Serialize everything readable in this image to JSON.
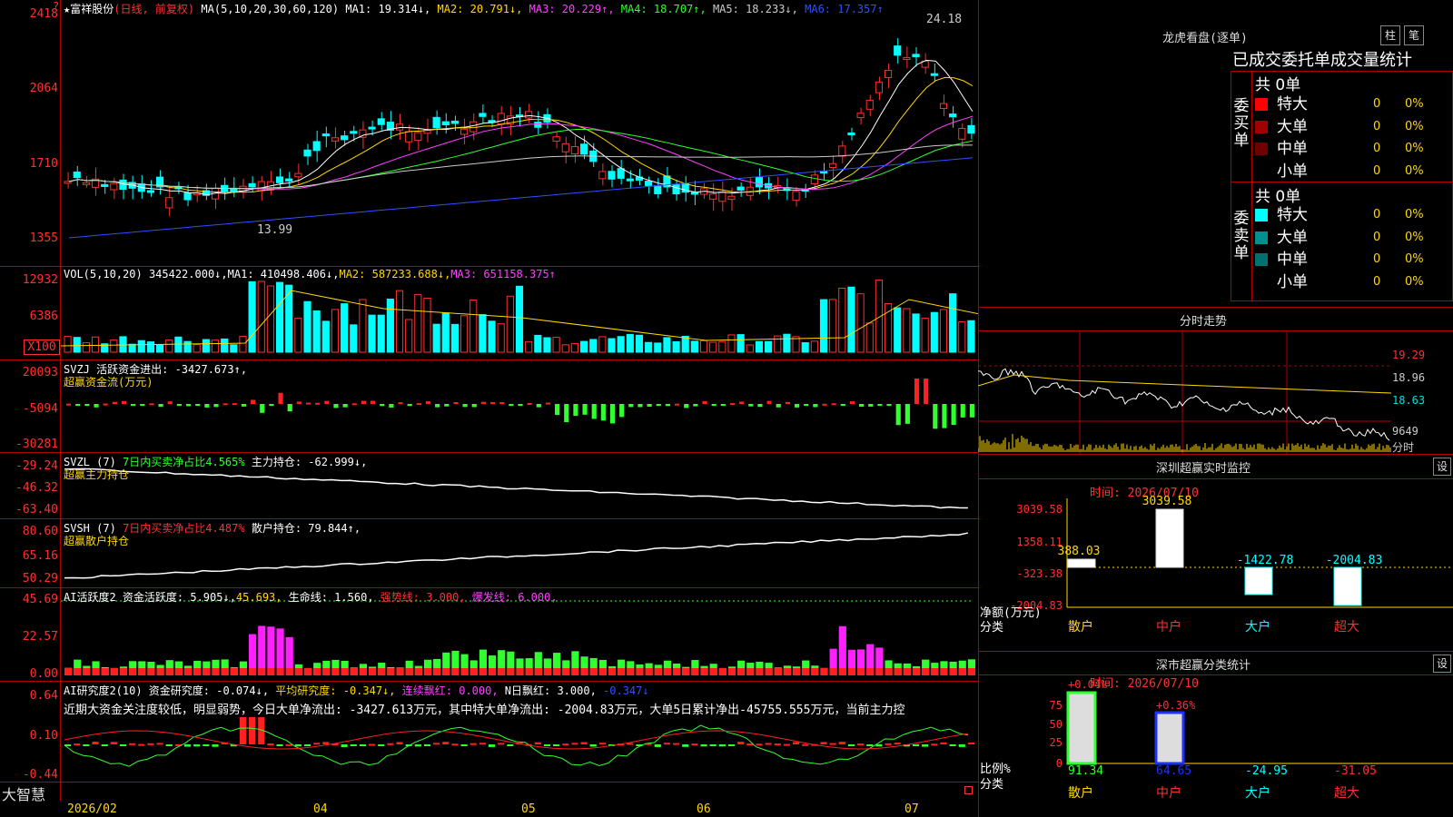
{
  "header": {
    "star": "★",
    "stock": "富祥股份",
    "period": "(日线, 前复权)",
    "ma_params": "MA(5,10,20,30,60,120)",
    "ma": [
      {
        "label": "MA1: 19.314↓,",
        "color": "#ffffff"
      },
      {
        "label": "MA2: 20.791↓,",
        "color": "#ffd800"
      },
      {
        "label": "MA3: 20.229↑,",
        "color": "#ff40ff"
      },
      {
        "label": "MA4: 18.707↑,",
        "color": "#30ff30"
      },
      {
        "label": "MA5: 18.233↓,",
        "color": "#cccccc"
      },
      {
        "label": "MA6: 17.357↑",
        "color": "#3050ff"
      }
    ]
  },
  "price": {
    "y_labels": [
      "2418",
      "2064",
      "1710",
      "1355"
    ],
    "high_label": "24.18",
    "low_label": "13.99"
  },
  "vol": {
    "header": "VOL(5,10,20)",
    "value": "345422.000↓,",
    "ma1": "MA1: 410498.406↓,",
    "ma2": "MA2: 587233.688↓,",
    "ma3": "MA3: 651158.375↑",
    "y_labels": [
      "12932",
      "6386"
    ],
    "unit": "X100"
  },
  "svzj": {
    "header": "SVZJ  活跃资金进出: -3427.673↑,",
    "tag": "超赢资金流(万元)",
    "y_labels": [
      "20093",
      "-5094",
      "-30281"
    ]
  },
  "svzl": {
    "h1": "SVZL (7)",
    "h2": "7日内买卖净占比4.565%",
    "h3": " 主力持仓: -62.999↓,",
    "tag": "超赢主力持仓",
    "y_labels": [
      "-29.24",
      "-46.32",
      "-63.40"
    ]
  },
  "svsh": {
    "h1": "SVSH (7)",
    "h2": "7日内买卖净占比4.487%",
    "h3": " 散户持仓: 79.844↑,",
    "tag": "超赢散户持仓",
    "y_labels": [
      "80.60",
      "65.16",
      "50.29"
    ]
  },
  "ai1": {
    "h1": "AI活跃度2 资金活跃度: 5.905↓,",
    "h2": "45.693,",
    "h3": " 生命线: 1.560,",
    "h4": " 强势线: 3.000,",
    "h5": " 爆发线: 6.000,",
    "y_labels": [
      "45.69",
      "22.57",
      "0.00"
    ]
  },
  "ai2": {
    "h1": "AI研究度2(10) 资金研究度: -0.074↓,",
    "h2": " 平均研究度: -0.347↓,",
    "h3": " 连续飘红: 0.000,",
    "h4": " N日飘红: 3.000,",
    "h5": " -0.347↓",
    "text": "近期大资金关注度较低，明显弱势，今日大单净流出: -3427.613万元，其中特大单净流出: -2004.83万元，大单5日累计净出-45755.555万元，当前主力控",
    "y_labels": [
      "0.64",
      "0.10",
      "-0.44"
    ]
  },
  "axis": {
    "brand": "大智慧",
    "months": [
      "2026/02",
      "04",
      "05",
      "06",
      "07"
    ]
  },
  "right": {
    "lh_title": "龙虎看盘(逐单)",
    "btn_bar": "柱",
    "btn_bi": "笔",
    "tabs": "已成交委托单成交量统计",
    "buy_label": "委买单",
    "sell_label": "委卖单",
    "buy_count": "共 0单",
    "sell_count": "共 0单",
    "buy_rows": [
      {
        "name": "特大",
        "n": "0",
        "p": "0%",
        "c": "#ff0000"
      },
      {
        "name": "大单",
        "n": "0",
        "p": "0%",
        "c": "#a00000"
      },
      {
        "name": "中单",
        "n": "0",
        "p": "0%",
        "c": "#700000"
      },
      {
        "name": "小单",
        "n": "0",
        "p": "0%",
        "c": "#000"
      }
    ],
    "sell_rows": [
      {
        "name": "特大",
        "n": "0",
        "p": "0%",
        "c": "#00ffff"
      },
      {
        "name": "大单",
        "n": "0",
        "p": "0%",
        "c": "#009090"
      },
      {
        "name": "中单",
        "n": "0",
        "p": "0%",
        "c": "#007070"
      },
      {
        "name": "小单",
        "n": "0",
        "p": "0%",
        "c": "#000"
      }
    ],
    "fs_title": "分时走势",
    "fs_labels": [
      "19.29",
      "18.96",
      "18.63",
      "9649",
      "分时"
    ],
    "sz_title": "深圳超赢实时监控",
    "sz_btn": "设",
    "sz_time": "时间: 2026/07/10",
    "sz_y": [
      "3039.58",
      "1358.11",
      "-323.38",
      "-2004.83"
    ],
    "sz_vals": [
      "388.03",
      "3039.58",
      "-1422.78",
      "-2004.83"
    ],
    "sz_axis": [
      "净额(万元)",
      "分类"
    ],
    "sz_cats": [
      "散户",
      "中户",
      "大户",
      "超大"
    ],
    "ss_title": "深市超赢分类统计",
    "ss_btn": "设",
    "ss_time": "时间: 2026/07/10",
    "ss_y": [
      "75",
      "50",
      "25",
      "0"
    ],
    "ss_top": [
      "+0.04%",
      "+0.36%"
    ],
    "ss_vals": [
      "91.34",
      "64.65",
      "-24.95",
      "-31.05"
    ],
    "ss_axis": [
      "比例%",
      "分类"
    ],
    "ss_cats": [
      "散户",
      "中户",
      "大户",
      "超大"
    ]
  }
}
